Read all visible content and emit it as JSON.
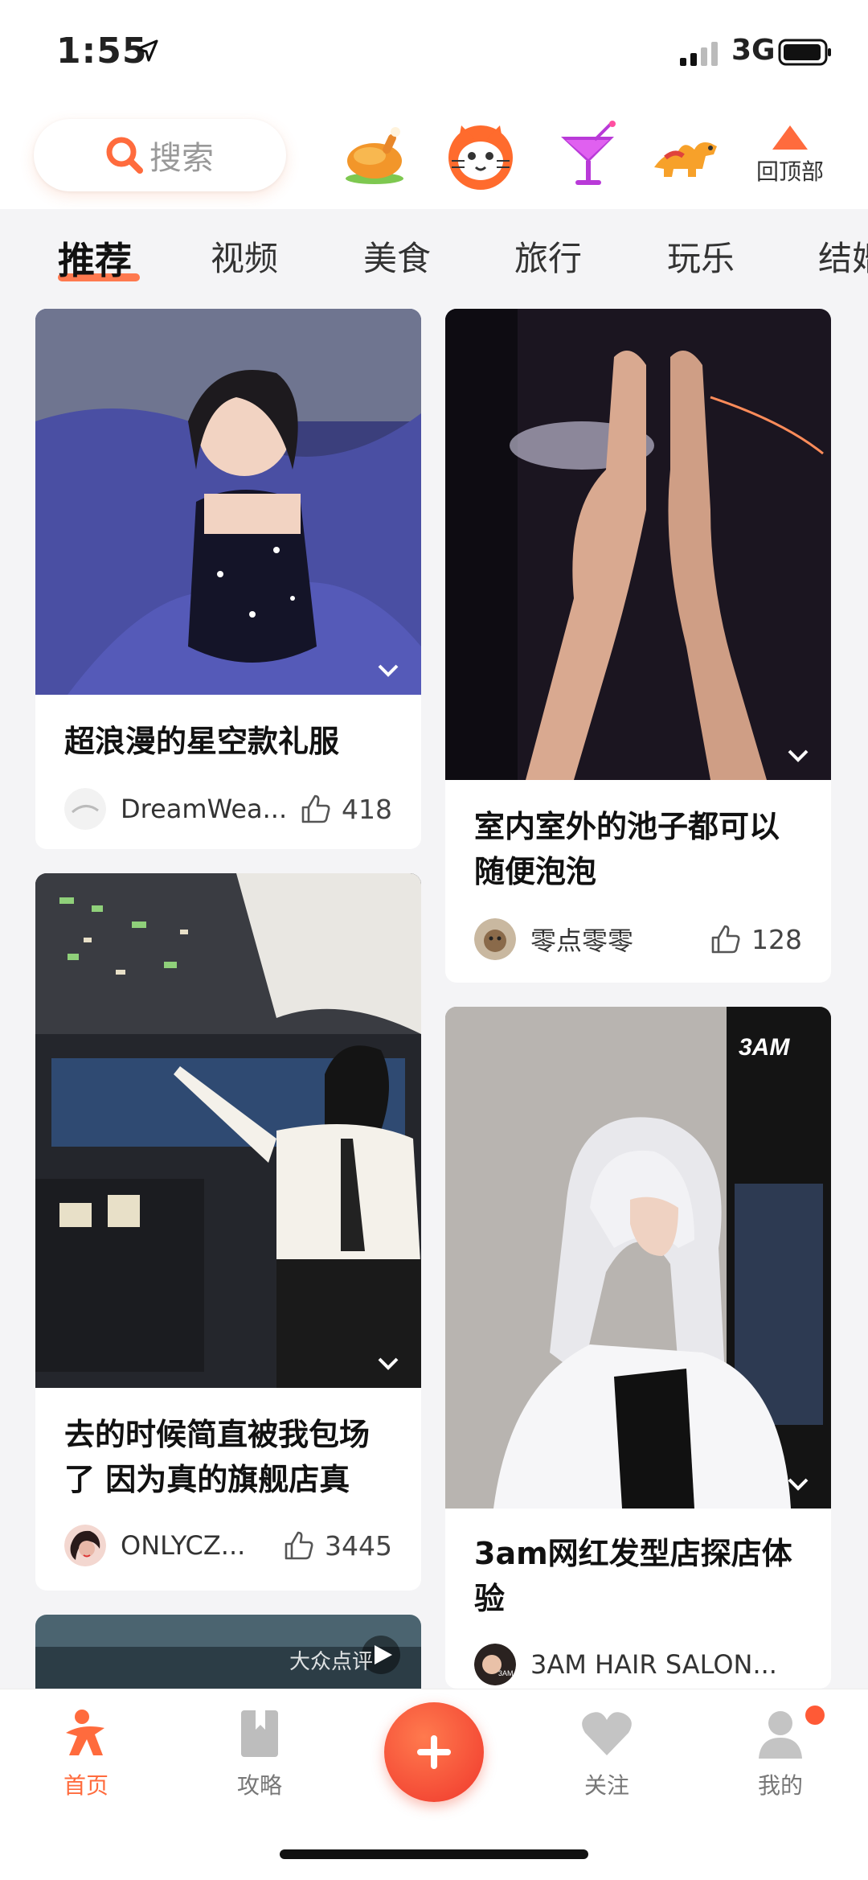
{
  "status_bar": {
    "time": "1:55",
    "network": "3G",
    "icons": [
      "location-arrow-icon",
      "signal-icon",
      "battery-icon"
    ]
  },
  "header": {
    "search_placeholder": "搜索",
    "quick_icons": [
      "roast-chicken-icon",
      "cat-face-icon",
      "cocktail-icon",
      "camel-icon"
    ],
    "back_to_top_label": "回顶部"
  },
  "tabs": [
    {
      "label": "推荐",
      "active": true
    },
    {
      "label": "视频",
      "active": false
    },
    {
      "label": "美食",
      "active": false
    },
    {
      "label": "旅行",
      "active": false
    },
    {
      "label": "玩乐",
      "active": false
    },
    {
      "label": "结婚",
      "active": false
    }
  ],
  "feed": [
    {
      "title": "超浪漫的星空款礼服",
      "author": "DreamWea...",
      "likes": "418",
      "image": "woman-in-starry-gown-photo"
    },
    {
      "title": "室内室外的池子都可以随便泡泡",
      "author": "零点零零",
      "likes": "128",
      "image": "legs-in-pool-photo"
    },
    {
      "title": "去的时候简直被我包场了 因为真的旗舰店真",
      "author": "ONLYCZ...",
      "likes": "3445",
      "image": "cockpit-photo"
    },
    {
      "title": "3am网红发型店探店体验",
      "author": "3AM HAIR SALON...",
      "likes": "",
      "image": "silver-hair-salon-photo",
      "sign_text": "3AM"
    },
    {
      "title": "",
      "author": "",
      "likes": "",
      "image": "video-thumbnail-photo",
      "watermark": "大众点评"
    }
  ],
  "tab_bar": {
    "items": [
      {
        "label": "首页",
        "icon": "home-icon",
        "active": true
      },
      {
        "label": "攻略",
        "icon": "bookmark-icon",
        "active": false
      },
      {
        "label": "关注",
        "icon": "heart-icon",
        "active": false
      },
      {
        "label": "我的",
        "icon": "profile-icon",
        "active": false
      }
    ],
    "add_icon": "plus-icon"
  },
  "colors": {
    "accent": "#ff6b3d",
    "background": "#f4f4f6",
    "card": "#ffffff"
  }
}
